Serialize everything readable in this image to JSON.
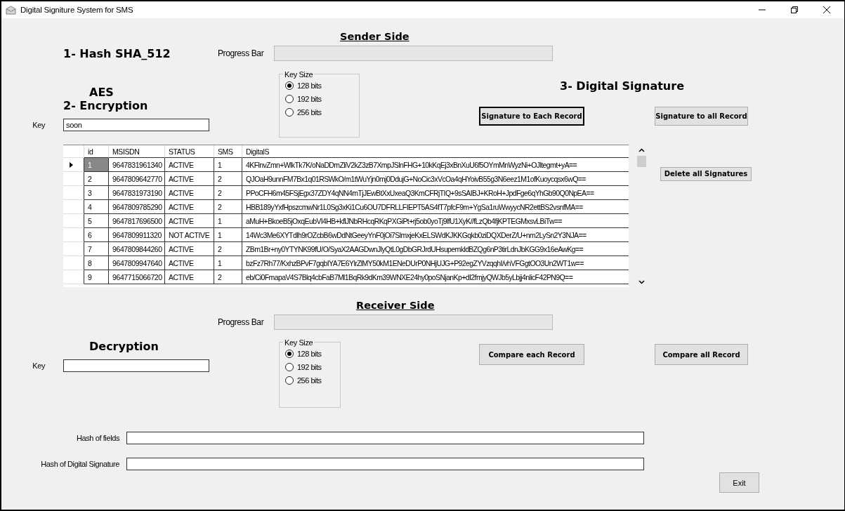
{
  "window": {
    "title": "Digital Signiture System for SMS"
  },
  "sender": {
    "heading": "Sender Side",
    "hash_title": "1- Hash SHA_512",
    "aes_label": "AES",
    "encryption_title": "2- Encryption",
    "key_label": "Key",
    "key_value": "soon",
    "progress_label": "Progress Bar",
    "progress": {
      "level": 0
    },
    "key_size": {
      "legend": "Key Size",
      "options": [
        {
          "label": "128 bits",
          "selected": true
        },
        {
          "label": "192 bits",
          "selected": false
        },
        {
          "label": "256 bits",
          "selected": false
        }
      ]
    },
    "signature_title": "3- Digital Signature",
    "buttons": [
      {
        "label": "Signature to Each Record",
        "focused": true
      },
      {
        "label": "Signature to all Record",
        "focused": false
      }
    ]
  },
  "table": {
    "columns": [
      "id",
      "MSISDN",
      "STATUS",
      "SMS",
      "DigitalS"
    ],
    "rows": [
      {
        "selected": true,
        "cells": [
          "1",
          "9647831961340",
          "ACTIVE",
          "1",
          "4KFlnvZmn+WlkTk7K/oNaDDmZliV2kZ3zB7XmpJSlnFHG+10kKqEj3xBnXuU6f5OYmMnWyzNi+OJltegmt+yA=="
        ]
      },
      {
        "selected": false,
        "cells": [
          "2",
          "9647809642770",
          "ACTIVE",
          "2",
          "QJOaH9unnFM7Bx1q01RSWkO/m1tWuYjn0mj0DdujG+NoCic3xVcOa4qHYoivB55g3N6eez1M1ofKuoycqsx6wQ=="
        ]
      },
      {
        "selected": false,
        "cells": [
          "3",
          "9647831973190",
          "ACTIVE",
          "2",
          "PPoCFH6m45FSjEgx37ZDY4qNN4mTjJEwBtXxUxeaQ3KmCFRjTIQ+9sSAIBJ+KRoH+JpdFge6qYhGb90Q0NpEA=="
        ]
      },
      {
        "selected": false,
        "cells": [
          "4",
          "9647809785290",
          "ACTIVE",
          "2",
          "HBB189yYxfHpszcmwNr1L0Sg3xKi1Cu6OU7DFRLLFIEPT5AS4fT7pfcF9m+YgSa1ruWwyycNR2ettBS2vsnfMA=="
        ]
      },
      {
        "selected": false,
        "cells": [
          "5",
          "9647817696500",
          "ACTIVE",
          "1",
          "aMuH+BkoeB5jOxqEubVI4HB+kflJNbRHcqRKqPXGiPt+rj5ob0yoTj9lfU1XyK//fLzQb4fjKPTEGMxsvLBiTw=="
        ]
      },
      {
        "selected": false,
        "cells": [
          "6",
          "9647809911320",
          "NOT ACTIVE",
          "1",
          "14Wc3Me6XYTdlh9rOZcbB6wDdNtGeeyYnF0jOi7SlmxjeKxELSWdKJKKGqkb0ziDQXDerZ/U+nm2LySn2Y3NJA=="
        ]
      },
      {
        "selected": false,
        "cells": [
          "7",
          "9647809844260",
          "ACTIVE",
          "2",
          "ZBm1Br+ny0YTYNK99fU/O/SyaX2AAGDwnJlyQtL0gDbGRJrdUHsupemkldBZQg6nP3tirLdnJbKGG9x16eAwKg=="
        ]
      },
      {
        "selected": false,
        "cells": [
          "8",
          "9647809947640",
          "ACTIVE",
          "1",
          "bzFz7Rh77/KxhzBPvF7gqbIYA7E6YlrZlMY50kM1ENeDUrP0NHjUJG+P92egZYVzqqhI/vhVFGgtOO3Un2WT1w=="
        ]
      },
      {
        "selected": false,
        "cells": [
          "9",
          "9647715066720",
          "ACTIVE",
          "2",
          "eb/Ci0FmapaV4S7Blq4cbFaB7Ml1BqRk9dKm39WNXE24hy0poSNjanKp+dI2fmjyQWJb5yLbjj4nlicF42PN9Q=="
        ]
      }
    ]
  },
  "delete_button": "Delete all Signatures",
  "receiver": {
    "heading": "Receiver Side",
    "progress_label": "Progress Bar",
    "progress": {
      "level": 0
    },
    "decryption_title": "Decryption",
    "key_label": "Key",
    "key_size": {
      "legend": "Key Size",
      "options": [
        {
          "label": "128 bits",
          "selected": true
        },
        {
          "label": "192 bits",
          "selected": false
        },
        {
          "label": "256 bits",
          "selected": false
        }
      ]
    },
    "buttons": [
      {
        "label": "Compare each Record",
        "focused": false
      },
      {
        "label": "Compare all Record",
        "focused": false
      }
    ],
    "hash_fields": [
      {
        "label": "Hash of fields"
      },
      {
        "label": "Hash of Digital Signature"
      }
    ]
  },
  "exit_button": "Exit"
}
